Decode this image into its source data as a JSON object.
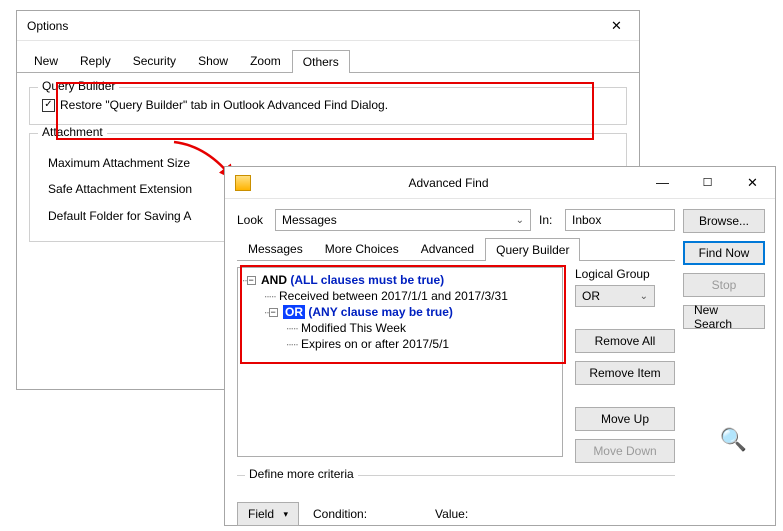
{
  "options": {
    "title": "Options",
    "tabs": [
      "New",
      "Reply",
      "Security",
      "Show",
      "Zoom",
      "Others"
    ],
    "activeTab": 5,
    "queryBuilder": {
      "legend": "Query Builder",
      "checkbox_checked": true,
      "checkbox_label": "Restore \"Query Builder\" tab in Outlook Advanced Find Dialog."
    },
    "attachment": {
      "legend": "Attachment",
      "rows": [
        "Maximum Attachment Size",
        "Safe Attachment Extension",
        "Default Folder for Saving A"
      ]
    }
  },
  "advfind": {
    "title": "Advanced Find",
    "look_label": "Look",
    "look_value": "Messages",
    "in_label": "In:",
    "in_value": "Inbox",
    "browse": "Browse...",
    "tabs": [
      "Messages",
      "More Choices",
      "Advanced",
      "Query Builder"
    ],
    "activeTab": 3,
    "tree": {
      "and_kw": "AND",
      "and_desc": "(ALL clauses must be true)",
      "and_child": "Received between 2017/1/1 and 2017/3/31",
      "or_kw": "OR",
      "or_desc": "(ANY clause may be true)",
      "or_children": [
        "Modified This Week",
        "Expires on or after 2017/5/1"
      ]
    },
    "side": {
      "logical_label": "Logical Group",
      "logical_value": "OR",
      "remove_all": "Remove All",
      "remove_item": "Remove Item",
      "move_up": "Move Up",
      "move_down": "Move Down"
    },
    "right": {
      "find_now": "Find Now",
      "stop": "Stop",
      "new_search": "New Search"
    },
    "define": {
      "legend": "Define more criteria",
      "field_btn": "Field",
      "condition_label": "Condition:",
      "value_label": "Value:"
    }
  }
}
